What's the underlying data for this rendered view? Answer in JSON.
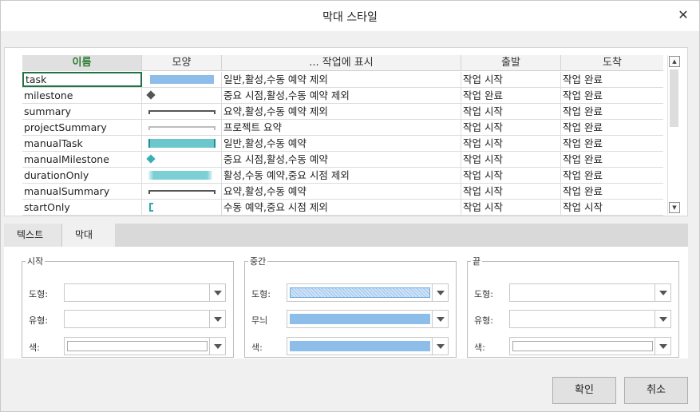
{
  "dialog": {
    "title": "막대 스타일",
    "close_glyph": "✕"
  },
  "grid": {
    "headers": {
      "name": "이름",
      "shape": "모양",
      "show": "... 작업에 표시",
      "from": "출발",
      "to": "도착"
    },
    "rows": [
      {
        "name": "task",
        "shape": "blue-bar",
        "show": "일반,활성,수동 예약 제외",
        "from": "작업 시작",
        "to": "작업 완료"
      },
      {
        "name": "milestone",
        "shape": "gray-diamond",
        "show": "중요 시점,활성,수동 예약 제외",
        "from": "작업 완료",
        "to": "작업 완료"
      },
      {
        "name": "summary",
        "shape": "dark-bracket",
        "show": "요약,활성,수동 예약 제외",
        "from": "작업 시작",
        "to": "작업 완료"
      },
      {
        "name": "projectSummary",
        "shape": "light-bracket",
        "show": "프로젝트 요약",
        "from": "작업 시작",
        "to": "작업 완료"
      },
      {
        "name": "manualTask",
        "shape": "teal-bar",
        "show": "일반,활성,수동 예약",
        "from": "작업 시작",
        "to": "작업 완료"
      },
      {
        "name": "manualMilestone",
        "shape": "teal-diamond",
        "show": "중요 시점,활성,수동 예약",
        "from": "작업 시작",
        "to": "작업 완료"
      },
      {
        "name": "durationOnly",
        "shape": "teal-faded-bar",
        "show": "활성,수동 예약,중요 시점 제외",
        "from": "작업 시작",
        "to": "작업 완료"
      },
      {
        "name": "manualSummary",
        "shape": "dark-bracket",
        "show": "요약,활성,수동 예약",
        "from": "작업 시작",
        "to": "작업 완료"
      },
      {
        "name": "startOnly",
        "shape": "teal-start-bracket",
        "show": "수동 예약,중요 시점 제외",
        "from": "작업 시작",
        "to": "작업 시작"
      }
    ]
  },
  "tabs": {
    "text": "텍스트",
    "bars": "막대",
    "active": "막대"
  },
  "groups": {
    "start": {
      "legend": "시작",
      "shape_label": "도형:",
      "type_label": "유형:",
      "color_label": "색:"
    },
    "middle": {
      "legend": "중간",
      "shape_label": "도형:",
      "pattern_label": "무늬",
      "color_label": "색:"
    },
    "end": {
      "legend": "끝",
      "shape_label": "도형:",
      "type_label": "유형:",
      "color_label": "색:"
    }
  },
  "colors": {
    "bar_blue": "#8dbde9",
    "teal": "#6cc7cd",
    "accent_green": "#217346"
  },
  "buttons": {
    "ok": "확인",
    "cancel": "취소"
  }
}
